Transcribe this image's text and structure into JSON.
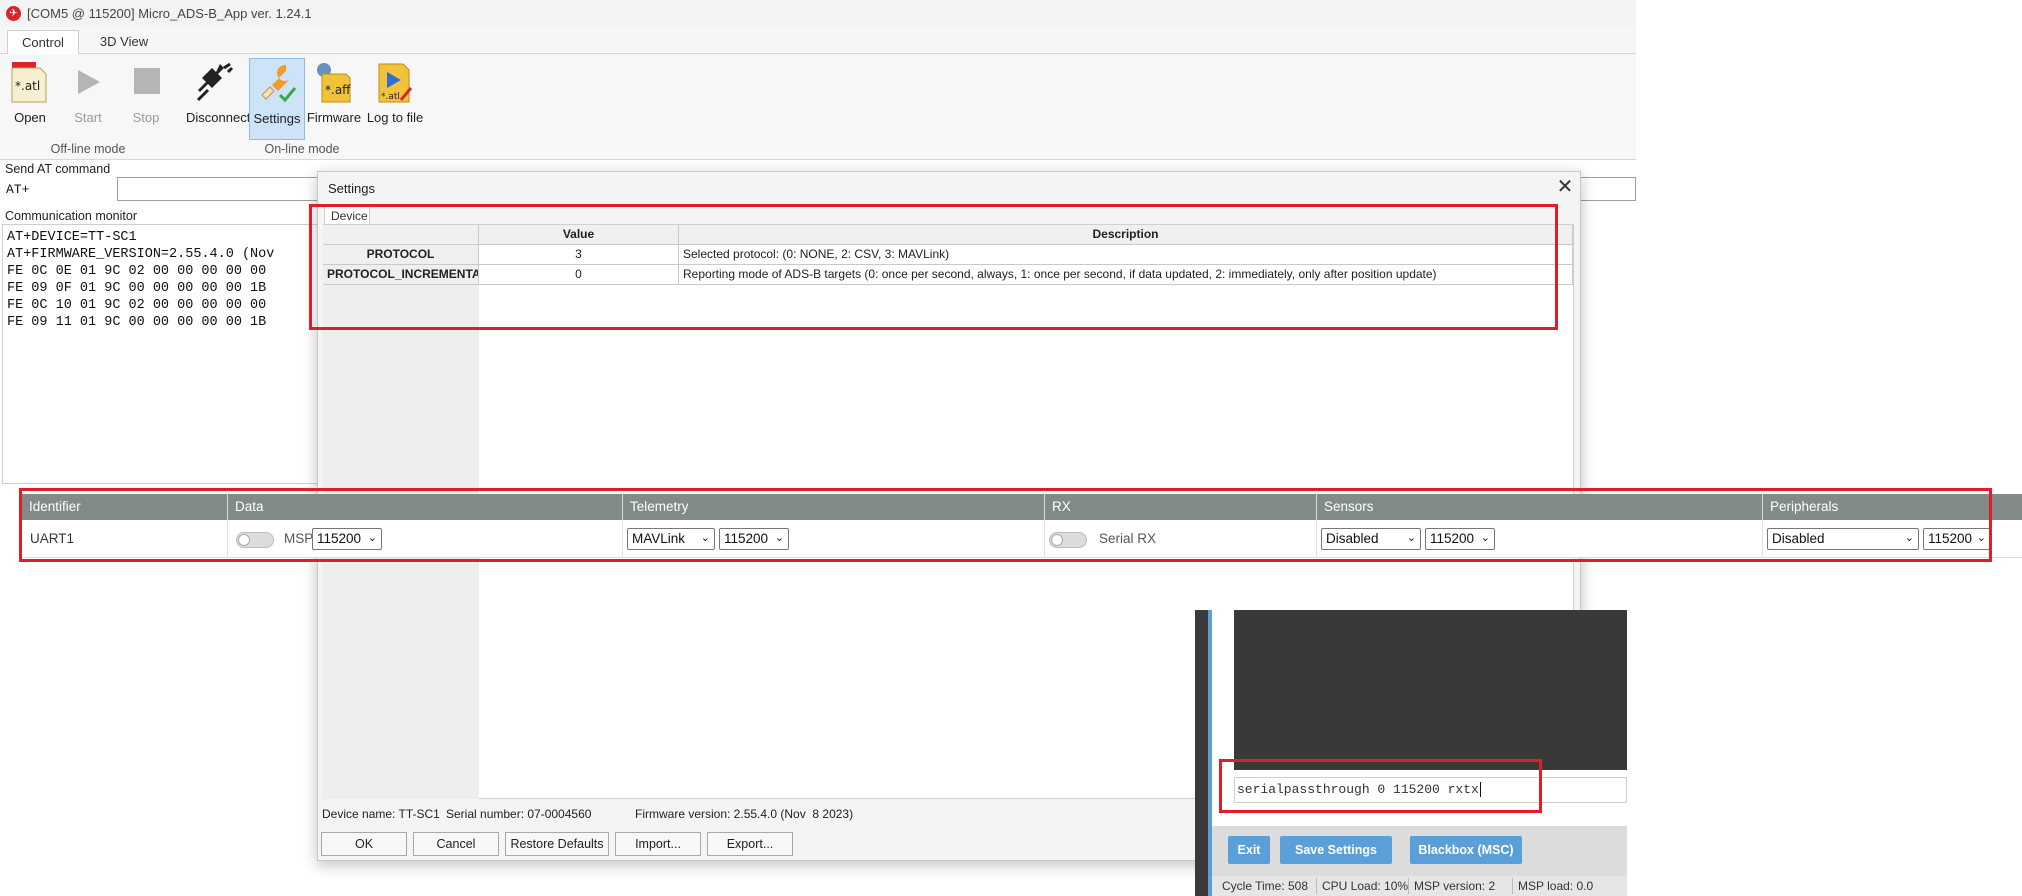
{
  "window": {
    "title": "[COM5 @ 115200] Micro_ADS-B_App ver. 1.24.1"
  },
  "tabs": [
    "Control",
    "3D View"
  ],
  "ribbon": {
    "open": "Open",
    "start": "Start",
    "stop": "Stop",
    "disconnect": "Disconnect",
    "settings": "Settings",
    "firmware": "Firmware",
    "log_to_file": "Log to file",
    "offline_group": "Off-line mode",
    "online_group": "On-line mode",
    "open_icon_text": "*.atl",
    "firmware_icon_text": "*.aff",
    "log_icon_text": "*.atl"
  },
  "at_command": {
    "label": "Send AT command",
    "prefix": "AT+"
  },
  "comm_monitor": {
    "label": "Communication monitor",
    "lines": [
      "AT+DEVICE=TT-SC1",
      "AT+FIRMWARE_VERSION=2.55.4.0 (Nov",
      "FE 0C 0E 01 9C 02 00 00 00 00 00",
      "FE 09 0F 01 9C 00 00 00 00 00 1B",
      "FE 0C 10 01 9C 02 00 00 00 00 00",
      "FE 09 11 01 9C 00 00 00 00 00 1B"
    ]
  },
  "settings_dialog": {
    "title": "Settings",
    "tab": "Device",
    "columns": {
      "value": "Value",
      "description": "Description"
    },
    "rows": [
      {
        "name": "PROTOCOL",
        "value": "3",
        "description": "Selected protocol: (0: NONE, 2: CSV, 3: MAVLink)"
      },
      {
        "name": "PROTOCOL_INCREMENTAL",
        "value": "0",
        "description": "Reporting mode of ADS-B targets (0: once per second, always, 1: once per second, if data updated, 2: immediately, only after position update)"
      }
    ],
    "device_name": "Device name: TT-SC1",
    "serial_number": "Serial number: 07-0004560",
    "firmware_version": "Firmware version: 2.55.4.0 (Nov  8 2023)",
    "buttons": {
      "ok": "OK",
      "cancel": "Cancel",
      "restore": "Restore Defaults",
      "import": "Import...",
      "export": "Export..."
    }
  },
  "ports": {
    "headers": [
      "Identifier",
      "Data",
      "Telemetry",
      "RX",
      "Sensors",
      "Peripherals"
    ],
    "row": {
      "identifier": "UART1",
      "data_label": "MSP",
      "data_baud": "115200",
      "telemetry_protocol": "MAVLink",
      "telemetry_baud": "115200",
      "rx_label": "Serial RX",
      "sensors_mode": "Disabled",
      "sensors_baud": "115200",
      "peripherals_mode": "Disabled",
      "peripherals_baud": "115200"
    }
  },
  "cli": {
    "command": "serialpassthrough 0 115200 rxtx",
    "buttons": {
      "exit": "Exit",
      "save": "Save Settings",
      "blackbox": "Blackbox (MSC)"
    },
    "status": {
      "cycle": "Cycle Time: 508",
      "cpu": "CPU Load: 10%",
      "msp": "MSP version: 2",
      "msp_load": "MSP load: 0.0"
    }
  },
  "colors": {
    "highlight": "#e01e2b",
    "cli_button": "#5a9fd8",
    "ports_header": "#828a8a"
  }
}
